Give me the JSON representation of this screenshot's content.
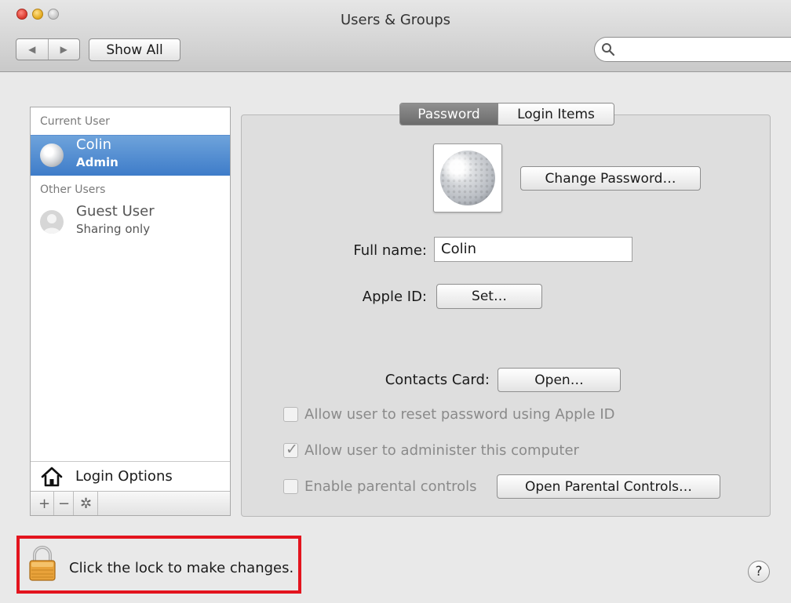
{
  "window": {
    "title": "Users & Groups"
  },
  "toolbar": {
    "back_glyph": "◀",
    "forward_glyph": "▶",
    "show_all_label": "Show All",
    "search_placeholder": ""
  },
  "sidebar": {
    "current_user_header": "Current User",
    "current_user": {
      "name": "Colin",
      "role": "Admin"
    },
    "other_users_header": "Other Users",
    "other_users": [
      {
        "name": "Guest User",
        "role": "Sharing only"
      }
    ],
    "login_options_label": "Login Options",
    "add_glyph": "+",
    "remove_glyph": "−",
    "gear_glyph": "✲"
  },
  "tabs": {
    "password": "Password",
    "login_items": "Login Items",
    "active": "password"
  },
  "password_panel": {
    "change_password_label": "Change Password…",
    "full_name_label": "Full name:",
    "full_name_value": "Colin",
    "apple_id_label": "Apple ID:",
    "set_label": "Set…",
    "contacts_card_label": "Contacts Card:",
    "open_label": "Open…",
    "allow_reset_label": "Allow user to reset password using Apple ID",
    "allow_reset_checked": false,
    "allow_admin_label": "Allow user to administer this computer",
    "allow_admin_checked": true,
    "parental_label": "Enable parental controls",
    "parental_checked": false,
    "open_parental_label": "Open Parental Controls…"
  },
  "footer": {
    "lock_text": "Click the lock to make changes.",
    "help_glyph": "?"
  },
  "colors": {
    "selection": "#3e7cc9",
    "highlight_box": "#e3141e"
  }
}
